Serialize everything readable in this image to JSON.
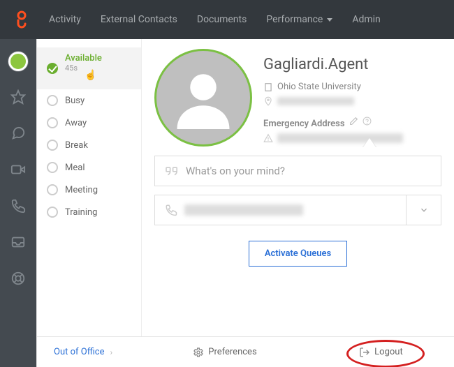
{
  "topnav": {
    "items": [
      "Activity",
      "External Contacts",
      "Documents",
      "Performance",
      "Admin"
    ],
    "dropdown_index": 3
  },
  "siderail": {
    "items": [
      "presence",
      "star",
      "chat",
      "video",
      "phone",
      "inbox",
      "help"
    ]
  },
  "status": {
    "items": [
      {
        "label": "Available",
        "sub": "45s",
        "selected": true
      },
      {
        "label": "Busy"
      },
      {
        "label": "Away"
      },
      {
        "label": "Break"
      },
      {
        "label": "Meal"
      },
      {
        "label": "Meeting"
      },
      {
        "label": "Training"
      }
    ]
  },
  "profile": {
    "name": "Gagliardi.Agent",
    "org": "Ohio State University",
    "emergency_label": "Emergency Address",
    "compose_placeholder": "What's on your mind?",
    "activate_label": "Activate Queues"
  },
  "footer": {
    "ooo": "Out of Office",
    "prefs": "Preferences",
    "logout": "Logout"
  }
}
